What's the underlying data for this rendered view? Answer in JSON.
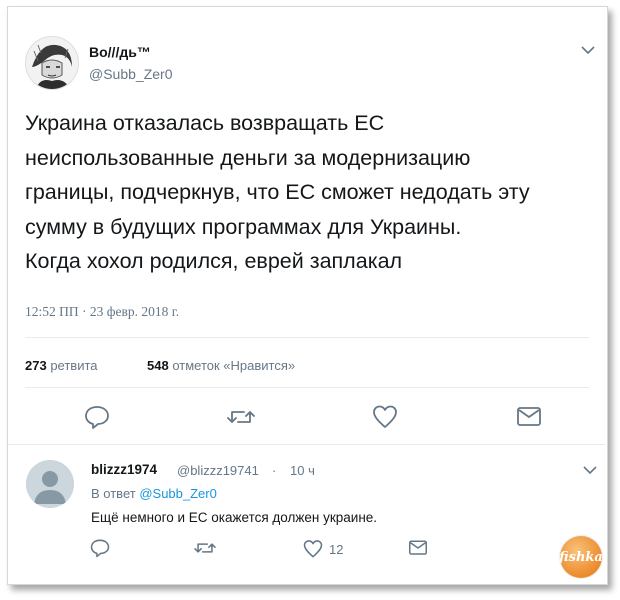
{
  "tweet": {
    "author_name": "Во///дь™",
    "author_handle": "@Subb_Zer0",
    "text_lines": [
      "Украина отказалась возвращать ЕС",
      "неиспользованные деньги за модернизацию",
      "границы, подчеркнув, что ЕС сможет недодать эту",
      "сумму в будущих программах для Украины.",
      "Когда хохол родился, еврей заплакал"
    ],
    "timestamp": "12:52 ПП · 23 февр. 2018 г.",
    "retweets_count": "273",
    "retweets_label": "ретвита",
    "likes_count": "548",
    "likes_label": "отметок «Нравится»"
  },
  "reply": {
    "author_name": "blizzz1974",
    "author_handle": "@blizzz19741",
    "dot": "·",
    "time": "10 ч",
    "reply_to_prefix": "В ответ",
    "reply_to_handle": "@Subb_Zer0",
    "text": "Ещё немного и ЕС окажется должен украине.",
    "like_count": "12"
  },
  "watermark": "fishka",
  "icons": {
    "more": "chevron-down-icon",
    "reply": "reply-icon",
    "retweet": "retweet-icon",
    "like": "heart-icon",
    "dm": "envelope-icon"
  },
  "colors": {
    "text": "#14171a",
    "secondary": "#657786",
    "link": "#1b95e0",
    "divider": "#e6ecf0"
  }
}
